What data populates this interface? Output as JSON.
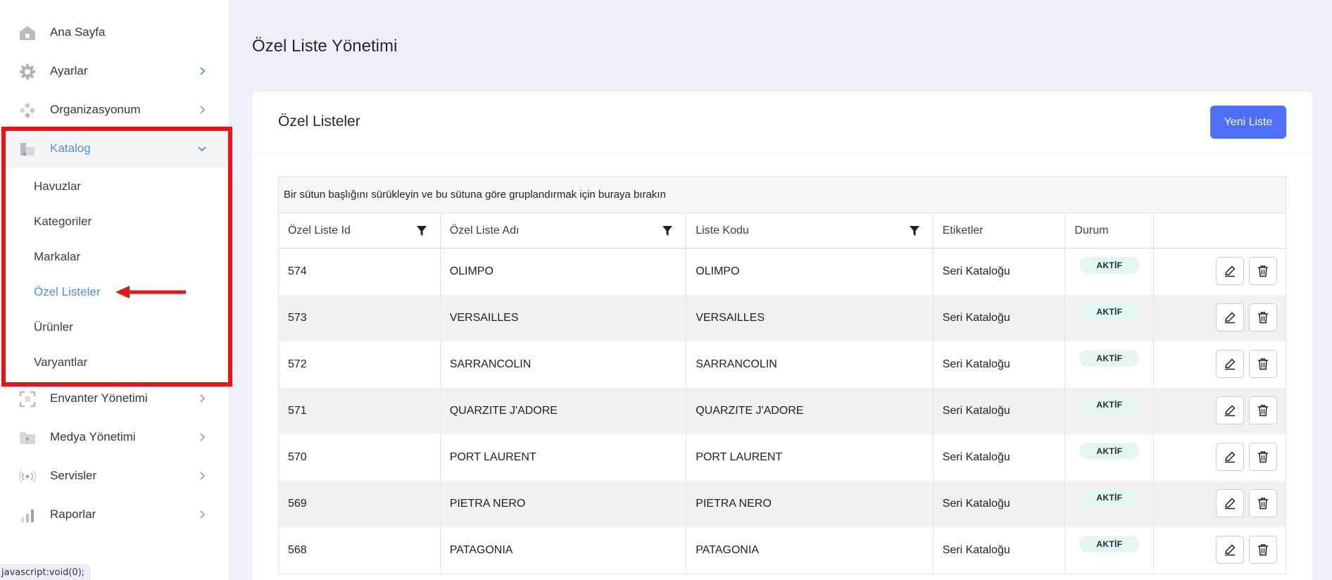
{
  "sidebar": {
    "items": [
      {
        "label": "Ana Sayfa",
        "icon": "home-icon"
      },
      {
        "label": "Ayarlar",
        "icon": "gear-icon"
      },
      {
        "label": "Organizasyonum",
        "icon": "organization-icon"
      },
      {
        "label": "Katalog",
        "icon": "catalog-icon"
      },
      {
        "label": "Envanter Yönetimi",
        "icon": "inventory-icon"
      },
      {
        "label": "Medya Yönetimi",
        "icon": "media-icon"
      },
      {
        "label": "Servisler",
        "icon": "services-icon"
      },
      {
        "label": "Raporlar",
        "icon": "reports-icon"
      }
    ],
    "katalog_sub": [
      {
        "label": "Havuzlar"
      },
      {
        "label": "Kategoriler"
      },
      {
        "label": "Markalar"
      },
      {
        "label": "Özel Listeler"
      },
      {
        "label": "Ürünler"
      },
      {
        "label": "Varyantlar"
      }
    ]
  },
  "statusbar": "javascript:void(0);",
  "main": {
    "page_title": "Özel Liste Yönetimi",
    "card_title": "Özel Listeler",
    "new_button": "Yeni Liste",
    "group_panel": "Bir sütun başlığını sürükleyin ve bu sütuna göre gruplandırmak için buraya bırakın",
    "columns": [
      "Özel Liste Id",
      "Özel Liste Adı",
      "Liste Kodu",
      "Etiketler",
      "Durum",
      ""
    ],
    "rows": [
      {
        "id": "574",
        "name": "OLIMPO",
        "code": "OLIMPO",
        "tags": "Seri Kataloğu",
        "status": "AKTİF"
      },
      {
        "id": "573",
        "name": "VERSAILLES",
        "code": "VERSAILLES",
        "tags": "Seri Kataloğu",
        "status": "AKTİF"
      },
      {
        "id": "572",
        "name": "SARRANCOLIN",
        "code": "SARRANCOLIN",
        "tags": "Seri Kataloğu",
        "status": "AKTİF"
      },
      {
        "id": "571",
        "name": "QUARZITE J'ADORE",
        "code": "QUARZITE J'ADORE",
        "tags": "Seri Kataloğu",
        "status": "AKTİF"
      },
      {
        "id": "570",
        "name": "PORT LAURENT",
        "code": "PORT LAURENT",
        "tags": "Seri Kataloğu",
        "status": "AKTİF"
      },
      {
        "id": "569",
        "name": "PIETRA NERO",
        "code": "PIETRA NERO",
        "tags": "Seri Kataloğu",
        "status": "AKTİF"
      },
      {
        "id": "568",
        "name": "PATAGONIA",
        "code": "PATAGONIA",
        "tags": "Seri Kataloğu",
        "status": "AKTİF"
      }
    ]
  },
  "colors": {
    "accent": "#4d6ef5",
    "active_link": "#4a90e2",
    "highlight": "#e8141a",
    "badge_bg": "#e3f7f0"
  }
}
